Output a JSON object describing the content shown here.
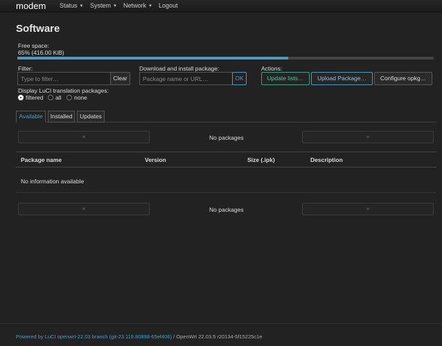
{
  "nav": {
    "brand": "modem",
    "items": [
      {
        "label": "Status",
        "dropdown": true
      },
      {
        "label": "System",
        "dropdown": true
      },
      {
        "label": "Network",
        "dropdown": true
      },
      {
        "label": "Logout",
        "dropdown": false
      }
    ]
  },
  "page": {
    "title": "Software"
  },
  "free_space": {
    "label": "Free space:",
    "value": "65% (416.00 KiB)",
    "percent": 65
  },
  "filter": {
    "label": "Filter:",
    "placeholder": "Type to filter…",
    "clear_label": "Clear"
  },
  "download": {
    "label": "Download and install package:",
    "placeholder": "Package name or URL…",
    "ok_label": "OK"
  },
  "actions": {
    "label": "Actions:",
    "update_lists": "Update lists…",
    "upload_package": "Upload Package…",
    "configure": "Configure opkg…"
  },
  "translation": {
    "label": "Display LuCI translation packages:",
    "options": [
      "filtered",
      "all",
      "none"
    ],
    "selected": "filtered"
  },
  "tabs": [
    {
      "label": "Available",
      "active": true
    },
    {
      "label": "Installed",
      "active": false
    },
    {
      "label": "Updates",
      "active": false
    }
  ],
  "pager": {
    "prev": "«",
    "next": "»",
    "status": "No packages"
  },
  "table": {
    "headers": [
      "Package name",
      "Version",
      "Size (.ipk)",
      "Description"
    ],
    "empty_text": "No information available"
  },
  "footer": {
    "link_text": "Powered by LuCI openwrt-22.03 branch (git-23.119.80898-65ef406)",
    "rest_text": " / OpenWrt 22.03.5 r20134-5f15225c1e"
  },
  "colors": {
    "accent": "#4c9cbf",
    "background": "#222222",
    "action_green": "#3aa283"
  }
}
